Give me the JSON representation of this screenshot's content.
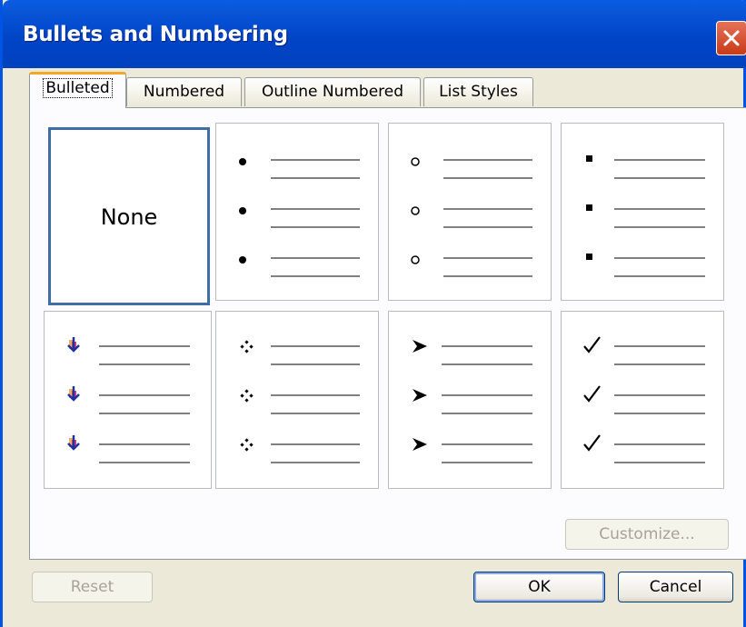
{
  "dialog": {
    "title": "Bullets and Numbering"
  },
  "tabs": [
    {
      "label": "Bulleted",
      "active": true
    },
    {
      "label": "Numbered",
      "active": false
    },
    {
      "label": "Outline Numbered",
      "active": false
    },
    {
      "label": "List Styles",
      "active": false
    }
  ],
  "gallery": {
    "none_label": "None",
    "bullet_styles": [
      "none",
      "filled-circle-bullet",
      "hollow-circle-bullet",
      "square-bullet",
      "picture-arrow-bullet",
      "four-diamond-bullet",
      "arrowhead-bullet",
      "checkmark-bullet"
    ],
    "selected_index": 0
  },
  "buttons": {
    "customize": "Customize...",
    "reset": "Reset",
    "ok": "OK",
    "cancel": "Cancel"
  },
  "colors": {
    "titlebar": "#0045c8",
    "selection_border": "#3f6ea6",
    "active_tab_accent": "#f5a623",
    "close_button": "#c83b17"
  }
}
